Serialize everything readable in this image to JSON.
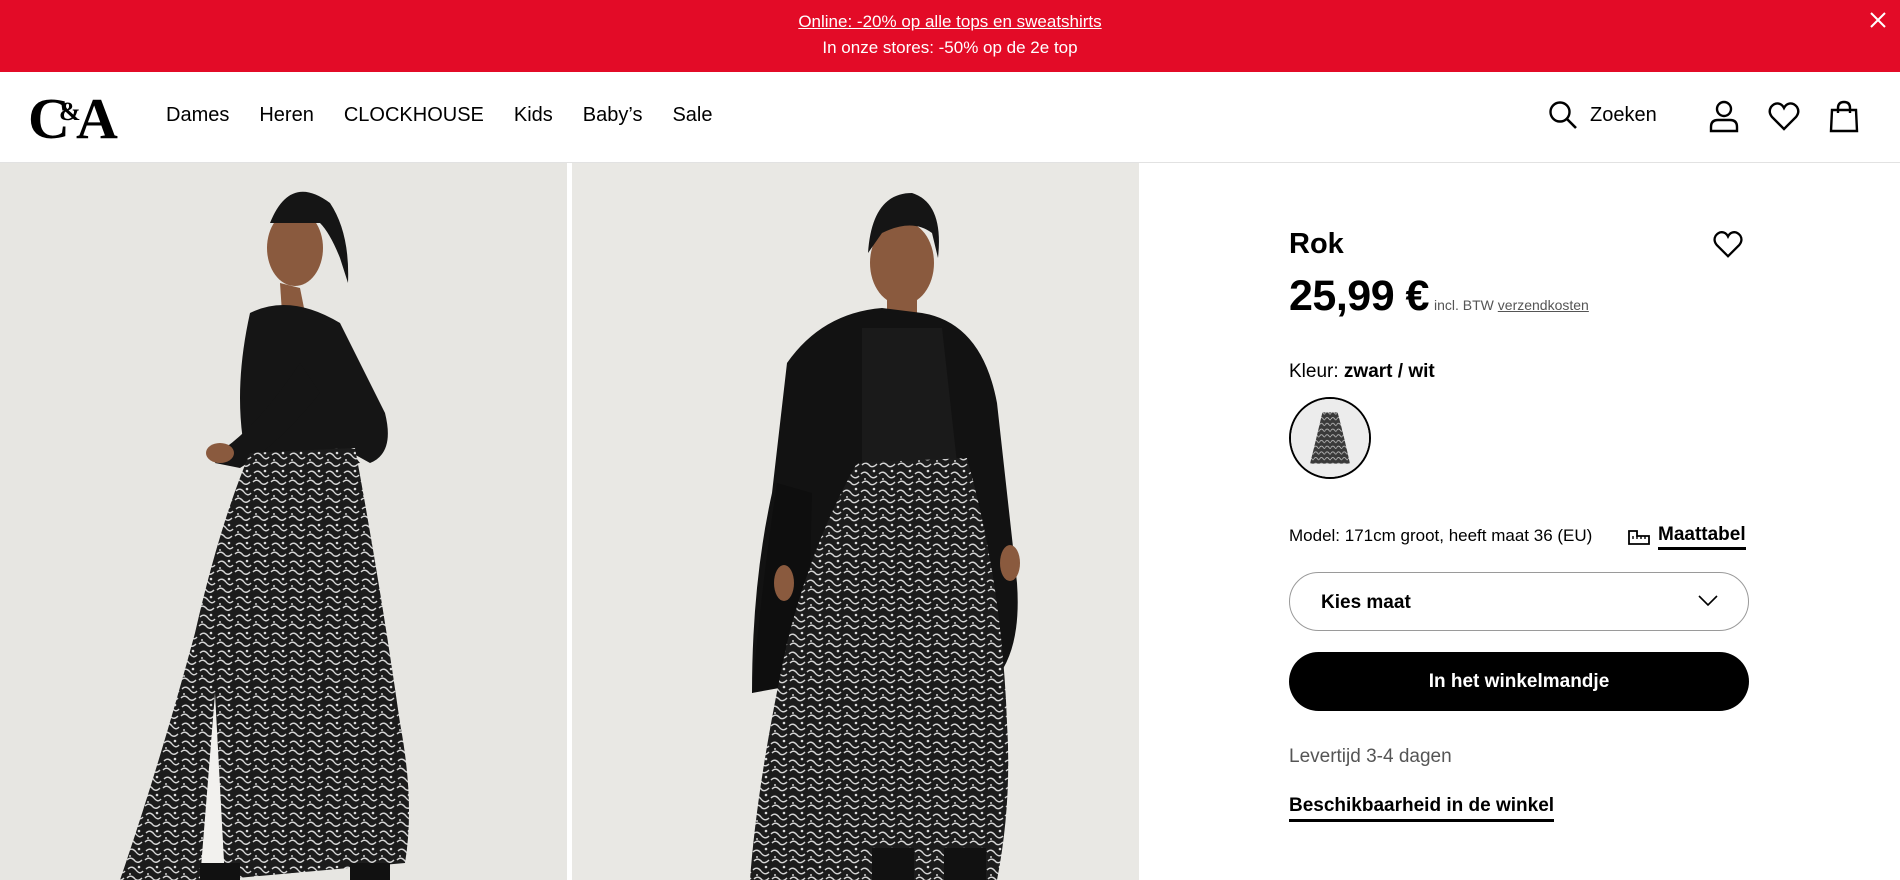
{
  "promo": {
    "line1": "Online: -20% op alle tops en sweatshirts",
    "line2": "In onze stores: -50% op de 2e top",
    "background": "#e30b27"
  },
  "header": {
    "logo": "C&A",
    "nav": [
      "Dames",
      "Heren",
      "CLOCKHOUSE",
      "Kids",
      "Baby’s",
      "Sale"
    ],
    "search_label": "Zoeken",
    "icons": [
      "search-icon",
      "account-icon",
      "wishlist-icon",
      "bag-icon"
    ]
  },
  "product": {
    "title": "Rok",
    "price": "25,99 €",
    "vat_text": "incl. BTW",
    "shipping_link": "verzendkosten",
    "color_label": "Kleur:",
    "color_value": "zwart / wit",
    "model_text": "Model: 171cm groot, heeft maat 36 (EU)",
    "size_chart_label": "Maattabel",
    "size_select_label": "Kies maat",
    "add_to_cart": "In het winkelmandje",
    "delivery": "Levertijd 3-4 dagen",
    "store_availability": "Beschikbaarheid in de winkel"
  }
}
